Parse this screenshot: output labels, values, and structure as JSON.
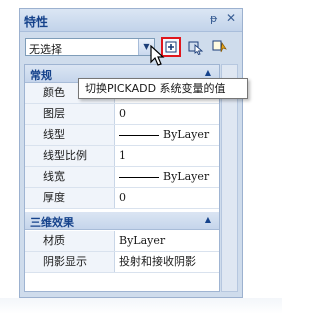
{
  "window": {
    "title": "特性",
    "pin_glyph": "ᵽ",
    "close_glyph": "✕"
  },
  "selector": {
    "value": "无选择",
    "arrow": "▼"
  },
  "toolbar": {
    "pickadd_icon": "pickadd-icon",
    "select_icon": "select-objects-icon",
    "quick_select_icon": "quick-select-icon"
  },
  "tooltip": {
    "text": "切换PICKADD 系统变量的值"
  },
  "sections": {
    "general": {
      "label": "常规",
      "rows": [
        {
          "label": "颜色",
          "value": ""
        },
        {
          "label": "图层",
          "value": "0"
        },
        {
          "label": "线型",
          "value": "ByLayer"
        },
        {
          "label": "线型比例",
          "value": "1"
        },
        {
          "label": "线宽",
          "value": "ByLayer"
        },
        {
          "label": "厚度",
          "value": "0"
        }
      ]
    },
    "three_d": {
      "label": "三维效果",
      "rows": [
        {
          "label": "材质",
          "value": "ByLayer"
        },
        {
          "label": "阴影显示",
          "value": "投射和接收阴影"
        }
      ]
    }
  },
  "colors": {
    "highlight_border": "#e0161c",
    "section_text": "#15428b"
  }
}
